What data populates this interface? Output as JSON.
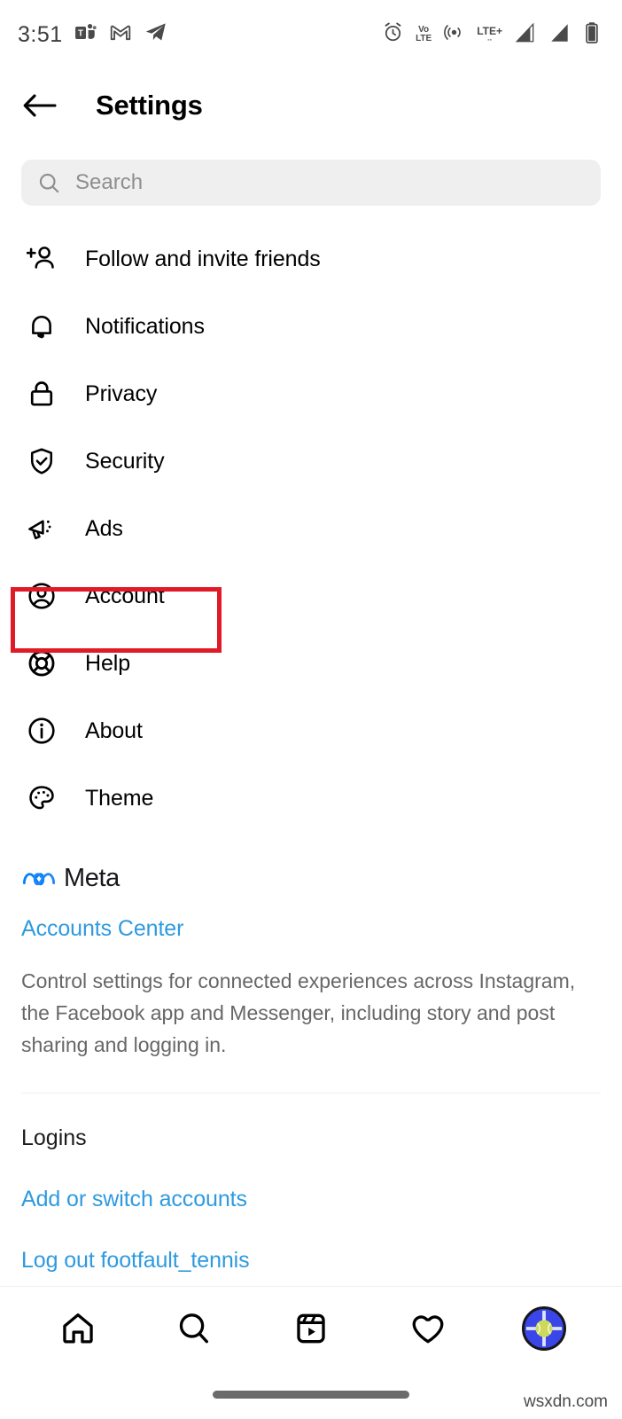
{
  "status_bar": {
    "time": "3:51",
    "left_icons": [
      "microsoft-teams-icon",
      "gmail-icon",
      "telegram-icon"
    ],
    "right_icons": [
      "alarm-icon",
      "volte-icon",
      "hotspot-icon",
      "lte-plus-icon",
      "signal-sim1-icon",
      "signal-sim2-icon",
      "battery-icon"
    ],
    "volte_top": "Vo",
    "volte_bottom": "LTE",
    "network": "LTE+"
  },
  "header": {
    "back_icon": "arrow-left-icon",
    "title": "Settings"
  },
  "search": {
    "placeholder": "Search",
    "value": "",
    "icon": "search-icon"
  },
  "menu": {
    "items": [
      {
        "label": "Follow and invite friends",
        "icon": "person-add-icon",
        "highlighted": false
      },
      {
        "label": "Notifications",
        "icon": "bell-icon",
        "highlighted": false
      },
      {
        "label": "Privacy",
        "icon": "lock-icon",
        "highlighted": false
      },
      {
        "label": "Security",
        "icon": "shield-check-icon",
        "highlighted": false
      },
      {
        "label": "Ads",
        "icon": "megaphone-icon",
        "highlighted": false
      },
      {
        "label": "Account",
        "icon": "account-circle-icon",
        "highlighted": true
      },
      {
        "label": "Help",
        "icon": "lifebuoy-icon",
        "highlighted": false
      },
      {
        "label": "About",
        "icon": "info-circle-icon",
        "highlighted": false
      },
      {
        "label": "Theme",
        "icon": "palette-icon",
        "highlighted": false
      }
    ]
  },
  "meta_section": {
    "logo_icon": "meta-infinity-icon",
    "brand": "Meta",
    "accounts_center_link": "Accounts Center",
    "description": "Control settings for connected experiences across Instagram, the Facebook app and Messenger, including story and post sharing and logging in."
  },
  "logins": {
    "heading": "Logins",
    "add_switch_link": "Add or switch accounts",
    "logout_link": "Log out footfault_tennis"
  },
  "bottom_nav": {
    "items": [
      {
        "name": "home",
        "icon": "home-icon"
      },
      {
        "name": "search",
        "icon": "search-icon"
      },
      {
        "name": "reels",
        "icon": "reels-icon"
      },
      {
        "name": "activity",
        "icon": "heart-icon"
      },
      {
        "name": "profile",
        "icon": "profile-avatar"
      }
    ]
  },
  "watermark": "wsxdn.com",
  "colors": {
    "link_blue": "#2e9ae0",
    "meta_blue": "#0082fb",
    "highlight_red": "#e01a26",
    "search_bg": "#efefef",
    "muted_text": "#676767",
    "avatar_bg": "#3b46e8",
    "tennis_ball": "#ccd95a"
  }
}
